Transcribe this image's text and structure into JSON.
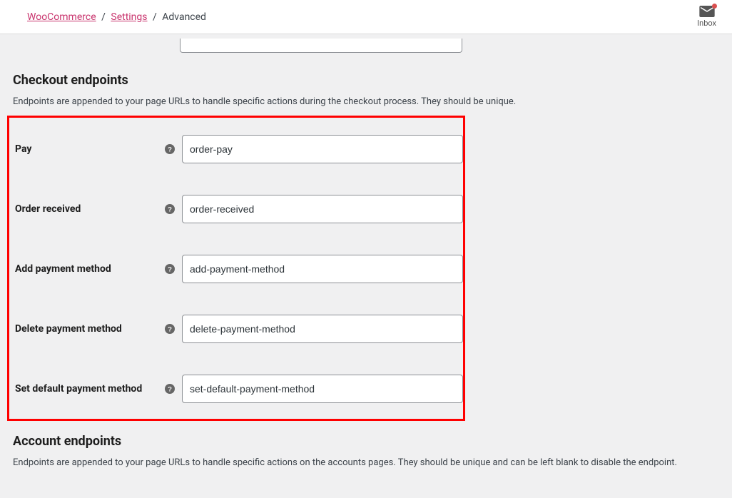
{
  "breadcrumb": {
    "root": "WooCommerce",
    "mid": "Settings",
    "leaf": "Advanced"
  },
  "inbox": {
    "label": "Inbox"
  },
  "checkout": {
    "title": "Checkout endpoints",
    "desc": "Endpoints are appended to your page URLs to handle specific actions during the checkout process. They should be unique.",
    "rows": [
      {
        "label": "Pay",
        "value": "order-pay"
      },
      {
        "label": "Order received",
        "value": "order-received"
      },
      {
        "label": "Add payment method",
        "value": "add-payment-method"
      },
      {
        "label": "Delete payment method",
        "value": "delete-payment-method"
      },
      {
        "label": "Set default payment method",
        "value": "set-default-payment-method"
      }
    ]
  },
  "account": {
    "title": "Account endpoints",
    "desc": "Endpoints are appended to your page URLs to handle specific actions on the accounts pages. They should be unique and can be left blank to disable the endpoint."
  }
}
